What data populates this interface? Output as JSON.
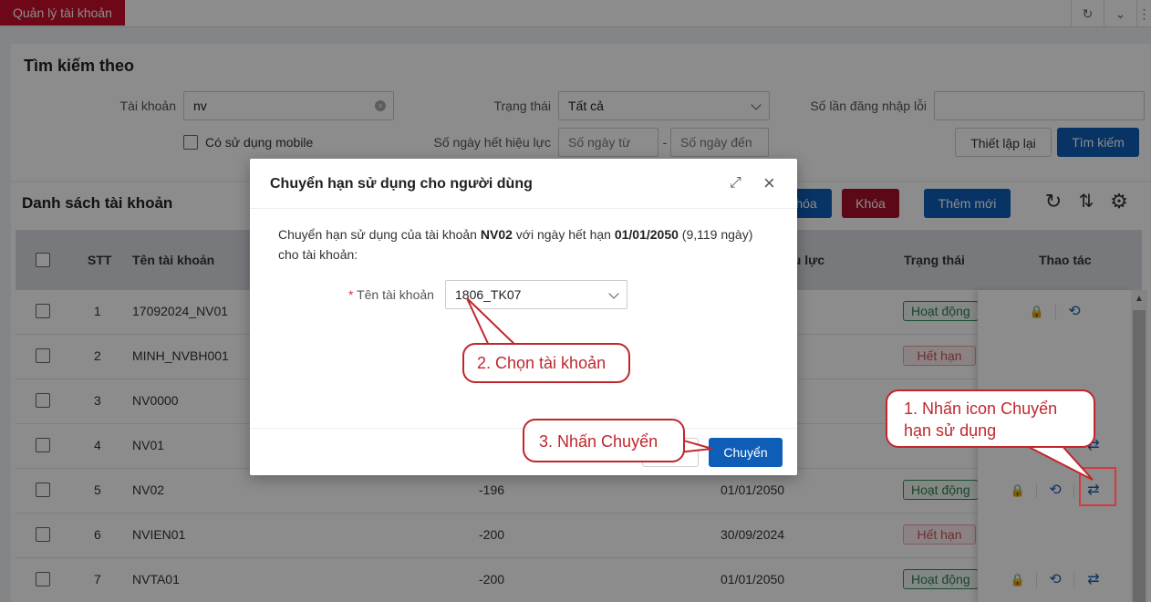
{
  "tabbar": {
    "active_tab": "Quản lý tài khoản"
  },
  "search": {
    "title": "Tìm kiếm theo",
    "account_label": "Tài khoản",
    "account_value": "nv",
    "status_label": "Trạng thái",
    "status_value": "Tất cả",
    "login_fail_label": "Số lần đăng nhập lỗi",
    "mobile_label": "Có sử dụng mobile",
    "expire_days_label": "Số ngày hết hiệu lực",
    "days_from_placeholder": "Số ngày từ",
    "days_to_placeholder": "Số ngày đến",
    "range_sep": "-",
    "reset_button": "Thiết lập lại",
    "search_button": "Tìm kiếm"
  },
  "list": {
    "title": "Danh sách tài khoản",
    "unlock_button_partial": "hóa",
    "lock_button": "Khóa",
    "add_button": "Thêm mới",
    "columns": {
      "stt": "STT",
      "account": "Tên tài khoản",
      "expiry_partial": "ệu lực",
      "status": "Trạng thái",
      "actions": "Thao tác"
    },
    "rows": [
      {
        "stt": "1",
        "name": "17092024_NV01",
        "days": "",
        "date": "",
        "status": "Hoạt động",
        "ok": true
      },
      {
        "stt": "2",
        "name": "MINH_NVBH001",
        "days": "",
        "date": "",
        "status": "Hết hạn",
        "ok": false
      },
      {
        "stt": "3",
        "name": "NV0000",
        "days": "",
        "date": "",
        "status": "",
        "ok": null
      },
      {
        "stt": "4",
        "name": "NV01",
        "days": "",
        "date": "",
        "status": "",
        "ok": null
      },
      {
        "stt": "5",
        "name": "NV02",
        "days": "-196",
        "date": "01/01/2050",
        "status": "Hoạt động",
        "ok": true
      },
      {
        "stt": "6",
        "name": "NVIEN01",
        "days": "-200",
        "date": "30/09/2024",
        "status": "Hết hạn",
        "ok": false
      },
      {
        "stt": "7",
        "name": "NVTA01",
        "days": "-200",
        "date": "01/01/2050",
        "status": "Hoạt động",
        "ok": true
      }
    ]
  },
  "modal": {
    "title": "Chuyển hạn sử dụng cho người dùng",
    "text_1": "Chuyển hạn sử dụng của tài khoản ",
    "account": "NV02",
    "text_2": " với ngày hết hạn ",
    "date": "01/01/2050",
    "text_3": " (9,119 ngày)",
    "text_4": "cho tài khoản:",
    "field_required_mark": "*",
    "field_label": "Tên tài khoản",
    "field_value": "1806_TK07",
    "submit_button": "Chuyển"
  },
  "callouts": {
    "step1": "1. Nhấn icon Chuyển hạn sử dụng",
    "step2": "2. Chọn tài khoản",
    "step3": "3. Nhấn Chuyển"
  },
  "colors": {
    "brand_red": "#c8102e",
    "primary_blue": "#0e5eb8",
    "callout_red": "#c0272d"
  }
}
